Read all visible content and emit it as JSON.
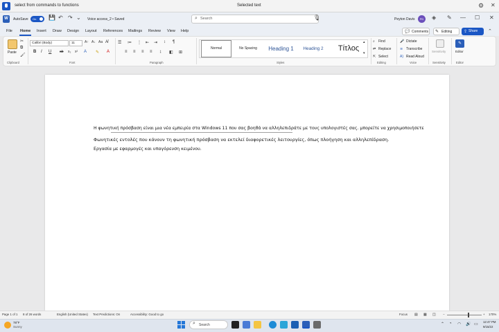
{
  "voice_access": {
    "command_text": "select from commands to functions",
    "state_text": "Selected text",
    "settings_icon": "gear-icon",
    "close_icon": "close-icon"
  },
  "titlebar": {
    "autosave_label": "AutoSave",
    "autosave_state": "On",
    "document_name": "Voice access_2 • Saved",
    "search_placeholder": "Search",
    "user_name": "Peyton Davis",
    "avatar_initials": "PD"
  },
  "tabs": [
    "File",
    "Home",
    "Insert",
    "Draw",
    "Design",
    "Layout",
    "References",
    "Mailings",
    "Review",
    "View",
    "Help"
  ],
  "actions": {
    "comments": "Comments",
    "editing": "Editing",
    "share": "Share"
  },
  "ribbon": {
    "paste_label": "Paste",
    "font_name": "Calibri (Body)",
    "font_size": "11",
    "styles": {
      "normal": "Normal",
      "no_spacing": "No Spacing",
      "heading1": "Heading 1",
      "heading2": "Heading 2",
      "title": "Τίτλος"
    },
    "find": "Find",
    "replace": "Replace",
    "select": "Select",
    "dictate": "Dictate",
    "transcribe": "Transcribe",
    "read_aloud": "Read Aloud",
    "sensitivity": "Sensitivity",
    "editor": "Editor",
    "groups": {
      "clipboard": "Clipboard",
      "font": "Font",
      "paragraph": "Paragraph",
      "styles": "Styles",
      "editing": "Editing",
      "voice": "Voice",
      "sensitivity": "Sensitivity",
      "editor": "Editor"
    }
  },
  "document": {
    "line1": "Η φωνητική πρόσβαση είναι μια νέα εμπειρία στα Windows 11 που σας βοηθά να αλληλεπιδράτε με τους υπολογιστές σας. μπορείτε να χρησιμοποιήσετε",
    "line2": "Φωνητικές εντολές που κάνουν τη φωνητική πρόσβαση να εκτελεί διαφορετικές λειτουργίες, όπως πλοήγηση και αλληλεπίδραση.",
    "line3": "Εργασία με εφαρμογές και υπαγόρευση κειμένου."
  },
  "statusbar": {
    "page": "Page 1 of 1",
    "words": "8 of 26 words",
    "language": "English (United States)",
    "text_predictions": "Text Predictions: On",
    "accessibility": "Accessibility: Good to go",
    "focus": "Focus",
    "zoom": "170%"
  },
  "taskbar": {
    "weather_temp": "78°F",
    "weather_cond": "Sunny",
    "search_label": "Search",
    "time": "12:47 PM",
    "date": "9/15/22"
  }
}
